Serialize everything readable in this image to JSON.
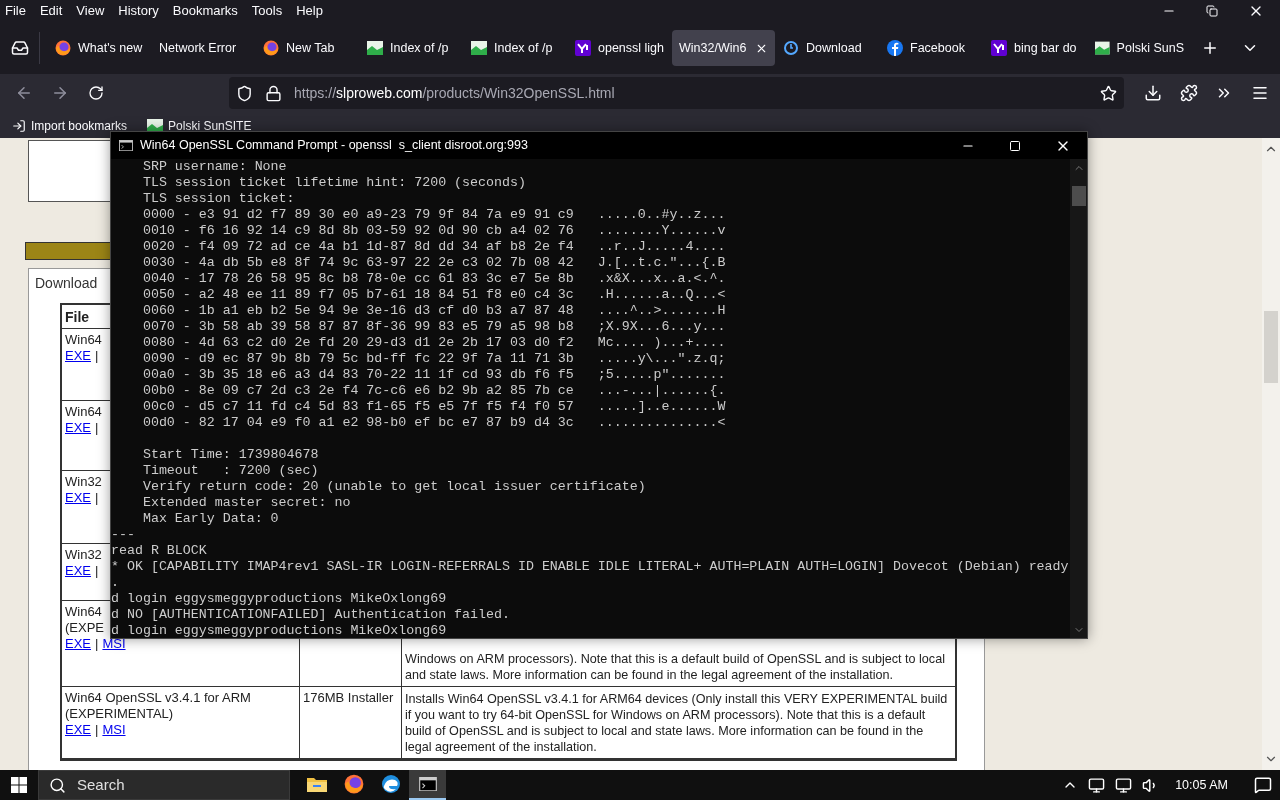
{
  "menu": [
    "File",
    "Edit",
    "View",
    "History",
    "Bookmarks",
    "Tools",
    "Help"
  ],
  "tabs": [
    {
      "label": "What's new",
      "kind": "firefox",
      "selected": false
    },
    {
      "label": "Network Error",
      "kind": "plain",
      "selected": false
    },
    {
      "label": "New Tab",
      "kind": "firefox",
      "selected": false
    },
    {
      "label": "Index of /p",
      "kind": "image",
      "selected": false
    },
    {
      "label": "Index of /p",
      "kind": "image",
      "selected": false
    },
    {
      "label": "openssl ligh",
      "kind": "yahoo",
      "selected": false
    },
    {
      "label": "Win32/Win6",
      "kind": "plain",
      "selected": true
    },
    {
      "label": "Download",
      "kind": "loader",
      "selected": false
    },
    {
      "label": "Facebook",
      "kind": "facebook",
      "selected": false
    },
    {
      "label": "bing bar do",
      "kind": "yahoo",
      "selected": false
    },
    {
      "label": "Polski SunS",
      "kind": "image",
      "selected": false
    }
  ],
  "url": {
    "scheme": "https://",
    "host": "slproweb.com",
    "path": "/products/Win32OpenSSL.html"
  },
  "bookmarks": [
    {
      "label": "Import bookmarks",
      "kind": "import"
    },
    {
      "label": "Polski SunSITE",
      "kind": "image"
    }
  ],
  "page": {
    "panel_title": "Download",
    "table": {
      "columns": [
        "File"
      ],
      "rows": [
        {
          "title_lines": [
            "Win64"
          ],
          "links": [
            "EXE"
          ],
          "separator": "|"
        },
        {
          "title_lines": [
            "Win64"
          ],
          "links": [
            "EXE"
          ],
          "separator": "|"
        },
        {
          "title_lines": [
            "Win32"
          ],
          "links": [
            "EXE"
          ],
          "separator": "|"
        },
        {
          "title_lines": [
            "Win32"
          ],
          "links": [
            "EXE"
          ],
          "separator": "|"
        },
        {
          "title_lines": [
            "Win64",
            "(EXPE"
          ],
          "links": [
            "EXE",
            "MSI"
          ],
          "separator": "|",
          "description": "Windows on ARM processors). Note that this is a default build of OpenSSL and is subject to local and state laws. More information can be found in the legal agreement of the installation."
        },
        {
          "title_lines": [
            "Win64 OpenSSL v3.4.1 for ARM (EXPERIMENTAL)"
          ],
          "links": [
            "EXE",
            "MSI"
          ],
          "separator": "|",
          "size": "176MB Installer",
          "description": "Installs Win64 OpenSSL v3.4.1 for ARM64 devices (Only install this VERY EXPERIMENTAL build if you want to try 64-bit OpenSSL for Windows on ARM processors). Note that this is a default build of OpenSSL and is subject to local and state laws. More information can be found in the legal agreement of the installation."
        }
      ]
    }
  },
  "terminal": {
    "title": "Win64 OpenSSL Command Prompt - openssl  s_client disroot.org:993",
    "blocks": [
      [
        "    SRP username: None",
        "    TLS session ticket lifetime hint: 7200 (seconds)",
        "    TLS session ticket:",
        "    0000 - e3 91 d2 f7 89 30 e0 a9-23 79 9f 84 7a e9 91 c9   .....0..#y..z...",
        "    0010 - f6 16 92 14 c9 8d 8b 03-59 92 0d 90 cb a4 02 76   ........Y......v",
        "    0020 - f4 09 72 ad ce 4a b1 1d-87 8d dd 34 af b8 2e f4   ..r..J.....4....",
        "    0030 - 4a db 5b e8 8f 74 9c 63-97 22 2e c3 02 7b 08 42   J.[..t.c.\"...{.B",
        "    0040 - 17 78 26 58 95 8c b8 78-0e cc 61 83 3c e7 5e 8b   .x&X...x..a.<.^.",
        "    0050 - a2 48 ee 11 89 f7 05 b7-61 18 84 51 f8 e0 c4 3c   .H......a..Q...<",
        "    0060 - 1b a1 eb b2 5e 94 9e 3e-16 d3 cf d0 b3 a7 87 48   ....^..>.......H",
        "    0070 - 3b 58 ab 39 58 87 87 8f-36 99 83 e5 79 a5 98 b8   ;X.9X...6...y...",
        "    0080 - 4d 63 c2 d0 2e fd 20 29-d3 d1 2e 2b 17 03 d0 f2   Mc.... )...+....",
        "    0090 - d9 ec 87 9b 8b 79 5c bd-ff fc 22 9f 7a 11 71 3b   .....y\\...\".z.q;",
        "    00a0 - 3b 35 18 e6 a3 d4 83 70-22 11 1f cd 93 db f6 f5   ;5.....p\".......",
        "    00b0 - 8e 09 c7 2d c3 2e f4 7c-c6 e6 b2 9b a2 85 7b ce   ...-...|......{.",
        "    00c0 - d5 c7 11 fd c4 5d 83 f1-65 f5 e5 7f f5 f4 f0 57   .....]..e......W",
        "    00d0 - 82 17 04 e9 f0 a1 e2 98-b0 ef bc e7 87 b9 d4 3c   ...............<"
      ],
      [
        "    Start Time: 1739804678",
        "    Timeout   : 7200 (sec)",
        "    Verify return code: 20 (unable to get local issuer certificate)",
        "    Extended master secret: no",
        "    Max Early Data: 0",
        "---",
        "read R BLOCK",
        "* OK [CAPABILITY IMAP4rev1 SASL-IR LOGIN-REFERRALS ID ENABLE IDLE LITERAL+ AUTH=PLAIN AUTH=LOGIN] Dovecot (Debian) ready",
        ".",
        "d login eggysmeggyproductions MikeOxlong69",
        "d NO [AUTHENTICATIONFAILED] Authentication failed.",
        "d login eggysmeggyproductions MikeOxlong69"
      ]
    ]
  },
  "taskbar": {
    "search_placeholder": "Search",
    "apps": [
      {
        "kind": "folder",
        "selected": false
      },
      {
        "kind": "firefox",
        "selected": false
      },
      {
        "kind": "edge",
        "selected": false
      },
      {
        "kind": "cmd",
        "selected": true
      }
    ],
    "time": "10:05 AM"
  }
}
